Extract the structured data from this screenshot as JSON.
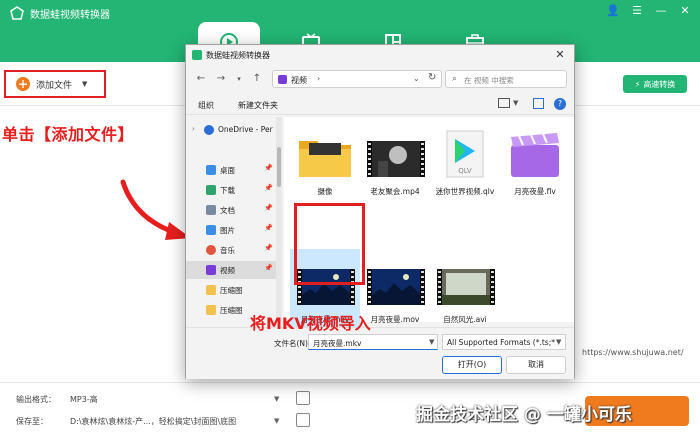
{
  "app": {
    "title": "数据蛙视频转换器",
    "add_file_label": "添加文件",
    "fast_convert_label": "高速转换",
    "output_format_label": "输出格式：",
    "output_format_value": "MP3-高",
    "save_to_label": "保存至：",
    "save_to_value": "D:\\袁林炫\\袁林炫-产...，轻松搞定\\封面图\\底图",
    "brand_color": "#22b573",
    "accent_color": "#f07a1e"
  },
  "annotations": {
    "click_text": "单击【添加文件】",
    "import_text": "将MKV视频导入",
    "color": "#e61e1e"
  },
  "watermarks": {
    "juejin": "掘金技术社区 @ 一罐小可乐",
    "site": "https://www.shujuwa.net/"
  },
  "dialog": {
    "title": "数据蛙视频转换器",
    "address_path": "视频",
    "search_placeholder": "在 视频 中搜索",
    "organize_label": "组织",
    "new_folder_label": "新建文件夹",
    "nav_items": [
      {
        "label": "OneDrive - Per",
        "icon": "cloud-icon",
        "color": "#2a6fd6"
      },
      {
        "label": "桌面",
        "icon": "desktop-icon",
        "color": "#3a8ee6"
      },
      {
        "label": "下载",
        "icon": "download-icon",
        "color": "#2fa36b"
      },
      {
        "label": "文档",
        "icon": "documents-icon",
        "color": "#7a8aa0"
      },
      {
        "label": "图片",
        "icon": "pictures-icon",
        "color": "#3a8ee6"
      },
      {
        "label": "音乐",
        "icon": "music-icon",
        "color": "#e2553c"
      },
      {
        "label": "视频",
        "icon": "videos-icon",
        "color": "#7a3cd6"
      },
      {
        "label": "压缩图",
        "icon": "folder-icon",
        "color": "#f2c14e"
      },
      {
        "label": "压缩图",
        "icon": "folder-icon",
        "color": "#f2c14e"
      }
    ],
    "files": [
      {
        "name": "摄像",
        "kind": "folder"
      },
      {
        "name": "老友聚会.mp4",
        "kind": "video"
      },
      {
        "name": "迷你世界视频.qlv",
        "kind": "qlv"
      },
      {
        "name": "月亮夜曼.flv",
        "kind": "clapper"
      },
      {
        "name": "月亮夜曼.mkv",
        "kind": "video"
      },
      {
        "name": "月亮夜曼.mov",
        "kind": "video"
      },
      {
        "name": "自然风光.avi",
        "kind": "video"
      }
    ],
    "filename_label": "文件名(N):",
    "filename_value": "月亮夜曼.mkv",
    "format_value": "All Supported Formats (*.ts;*",
    "open_label": "打开(O)",
    "cancel_label": "取消",
    "close_glyph": "✕"
  }
}
